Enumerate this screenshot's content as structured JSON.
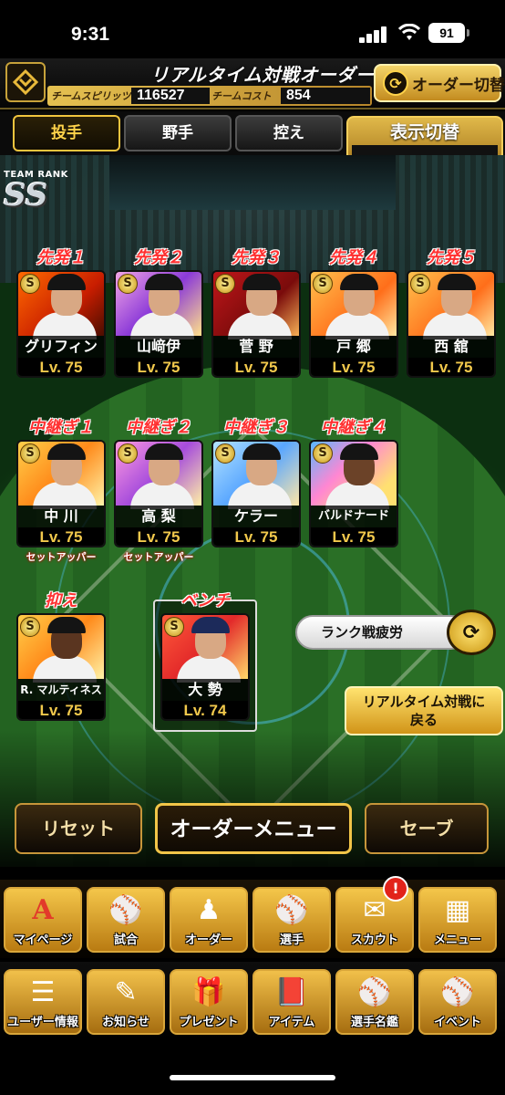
{
  "status_bar": {
    "time": "9:31",
    "battery": "91",
    "icons": [
      "signal-icon",
      "wifi-icon",
      "battery-icon"
    ]
  },
  "header": {
    "title": "リアルタイム対戦オーダー",
    "team_spirits_label": "チームスピリッツ",
    "team_spirits_value": "116527",
    "team_cost_label": "チームコスト",
    "team_cost_value": "854",
    "order_switch_label": "オーダー切替"
  },
  "tabs": [
    {
      "label": "投手",
      "active": true
    },
    {
      "label": "野手",
      "active": false
    },
    {
      "label": "控え",
      "active": false
    }
  ],
  "view_toggle": {
    "title": "表示切替",
    "value": "ー"
  },
  "team_rank": {
    "label": "TEAM RANK",
    "value": "SS"
  },
  "starters": [
    {
      "slot": "先発１",
      "name": "グリフィン",
      "level": "Lv. 75",
      "icon": "S"
    },
    {
      "slot": "先発２",
      "name": "山﨑伊",
      "level": "Lv. 75",
      "icon": "S"
    },
    {
      "slot": "先発３",
      "name": "菅 野",
      "level": "Lv. 75",
      "icon": "S"
    },
    {
      "slot": "先発４",
      "name": "戸 郷",
      "level": "Lv. 75",
      "icon": "S"
    },
    {
      "slot": "先発５",
      "name": "西 舘",
      "level": "Lv. 75",
      "icon": "S"
    }
  ],
  "relievers": [
    {
      "slot": "中継ぎ１",
      "name": "中 川",
      "level": "Lv. 75",
      "role": "セットアッパー",
      "icon": "S"
    },
    {
      "slot": "中継ぎ２",
      "name": "高 梨",
      "level": "Lv. 75",
      "role": "セットアッパー",
      "icon": "S"
    },
    {
      "slot": "中継ぎ３",
      "name": "ケラー",
      "level": "Lv. 75",
      "role": "",
      "icon": "S"
    },
    {
      "slot": "中継ぎ４",
      "name": "バルドナード",
      "level": "Lv. 75",
      "role": "",
      "icon": "S"
    }
  ],
  "closer": {
    "slot": "抑え",
    "name": "R. マルティネス",
    "level": "Lv. 75",
    "icon": "S"
  },
  "bench": {
    "slot": "ベンチ",
    "name": "大 勢",
    "level": "Lv. 74",
    "icon": "S"
  },
  "fatigue": {
    "label": "ランク戦疲労"
  },
  "back_button": {
    "line1": "リアルタイム対戦に",
    "line2": "戻る"
  },
  "order_buttons": {
    "reset": "リセット",
    "order_menu": "オーダーメニュー",
    "save": "セーブ"
  },
  "nav_row1": [
    {
      "label": "マイページ",
      "icon": "mypage-icon",
      "glyph": "A"
    },
    {
      "label": "試合",
      "icon": "stadium-icon",
      "glyph": "⚾"
    },
    {
      "label": "オーダー",
      "icon": "order-icon",
      "glyph": "♟"
    },
    {
      "label": "選手",
      "icon": "player-icon",
      "glyph": "⚾"
    },
    {
      "label": "スカウト",
      "icon": "scout-icon",
      "glyph": "✉"
    },
    {
      "label": "メニュー",
      "icon": "menu-icon",
      "glyph": "▦"
    }
  ],
  "nav_row2": [
    {
      "label": "ユーザー情報",
      "icon": "user-info-icon",
      "glyph": "☰"
    },
    {
      "label": "お知らせ",
      "icon": "news-icon",
      "glyph": "✎"
    },
    {
      "label": "プレゼント",
      "icon": "present-icon",
      "glyph": "🎁"
    },
    {
      "label": "アイテム",
      "icon": "item-icon",
      "glyph": "📕"
    },
    {
      "label": "選手名鑑",
      "icon": "player-book-icon",
      "glyph": "⚾"
    },
    {
      "label": "イベント",
      "icon": "event-icon",
      "glyph": "⚾"
    }
  ],
  "scout_badge": "!",
  "colors": {
    "accent_gold": "#f1c548",
    "slot_red": "#ff3030",
    "level_gold": "#f2c94c"
  }
}
